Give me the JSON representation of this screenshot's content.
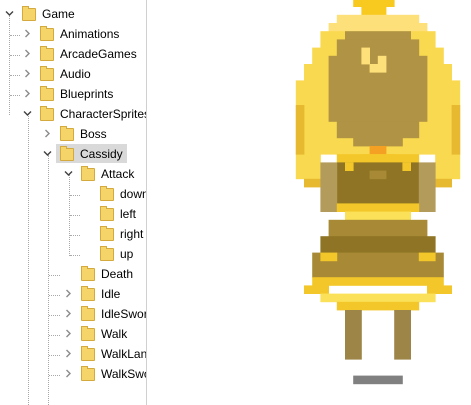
{
  "tree": {
    "items": [
      {
        "label": "Game",
        "expanded": true
      },
      {
        "label": "Animations",
        "expanded": false
      },
      {
        "label": "ArcadeGames",
        "expanded": false
      },
      {
        "label": "Audio",
        "expanded": false
      },
      {
        "label": "Blueprints",
        "expanded": false
      },
      {
        "label": "CharacterSprites",
        "expanded": true
      },
      {
        "label": "Boss",
        "expanded": false
      },
      {
        "label": "Cassidy",
        "expanded": true,
        "selected": true
      },
      {
        "label": "Attack",
        "expanded": true
      },
      {
        "label": "down"
      },
      {
        "label": "left"
      },
      {
        "label": "right"
      },
      {
        "label": "up"
      },
      {
        "label": "Death"
      },
      {
        "label": "Idle",
        "expanded": false
      },
      {
        "label": "IdleSword",
        "expanded": false
      },
      {
        "label": "Walk",
        "expanded": false
      },
      {
        "label": "WalkLantern",
        "expanded": false
      },
      {
        "label": "WalkSword",
        "expanded": false
      }
    ]
  },
  "preview": {
    "subject": "Cassidy sprite (attack, up)",
    "colors": {
      "hair_light": "#fde07a",
      "hair_main": "#f9d94f",
      "hair_shadow": "#e7b931",
      "back_of_head": "#b09345",
      "skin": "#b39b5b",
      "dress_dark": "#8e7424",
      "dress_mid": "#a88a36",
      "ribbon": "#f3c729",
      "ribbon_light": "#fbe15a",
      "bow": "#f4a022",
      "boot": "#9d8547",
      "crown": "#f8c91e",
      "shadow": "#808080"
    }
  }
}
